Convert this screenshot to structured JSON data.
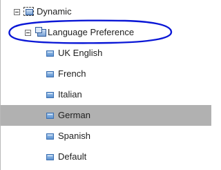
{
  "tree": {
    "root": {
      "label": "Dynamic",
      "icon": "dynamic-container-icon",
      "expanded": true
    },
    "group": {
      "label": "Language Preference",
      "icon": "folder-icon",
      "expanded": true
    },
    "items": [
      {
        "label": "UK English",
        "icon": "segment-icon",
        "selected": false
      },
      {
        "label": "French",
        "icon": "segment-icon",
        "selected": false
      },
      {
        "label": "Italian",
        "icon": "segment-icon",
        "selected": false
      },
      {
        "label": "German",
        "icon": "segment-icon",
        "selected": true
      },
      {
        "label": "Spanish",
        "icon": "segment-icon",
        "selected": false
      },
      {
        "label": "Default",
        "icon": "segment-icon",
        "selected": false
      }
    ]
  },
  "colors": {
    "selected_row": "#b1b1b1",
    "annotation_stroke": "#0a17d6"
  }
}
